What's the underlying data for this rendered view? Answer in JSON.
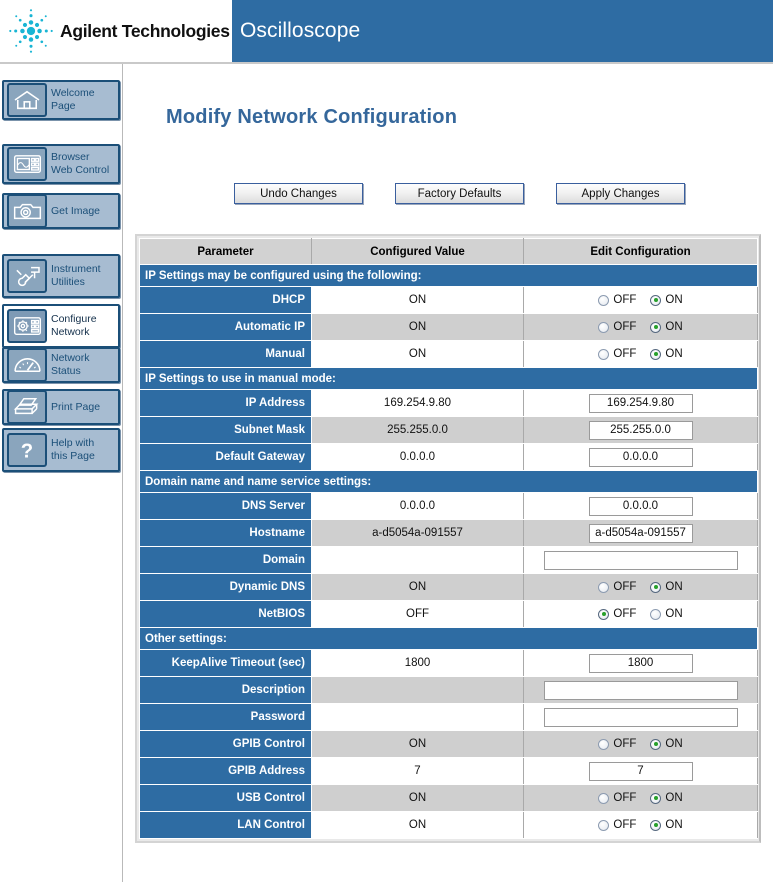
{
  "header": {
    "brand": "Agilent Technologies",
    "app_title": "Oscilloscope",
    "logo_icon": "agilent-starburst-icon",
    "brand_dot_color": "#19b5d4",
    "band_color": "#2e6ca3"
  },
  "sidebar": {
    "items": [
      {
        "label_lines": [
          "Welcome Page"
        ],
        "icon": "house-icon",
        "active": false
      },
      {
        "label_lines": [
          "Browser",
          "Web Control"
        ],
        "icon": "scope-screen-icon",
        "active": false
      },
      {
        "label_lines": [
          "Get Image"
        ],
        "icon": "camera-icon",
        "active": false
      },
      {
        "label_lines": [
          "Instrument",
          "Utilities"
        ],
        "icon": "wrench-tools-icon",
        "active": false
      },
      {
        "label_lines": [
          "Configure",
          "Network"
        ],
        "icon": "gear-scope-icon",
        "active": true
      },
      {
        "label_lines": [
          "Network Status"
        ],
        "icon": "gauge-icon",
        "active": false
      },
      {
        "label_lines": [
          "Print Page"
        ],
        "icon": "printer-icon",
        "active": false
      },
      {
        "label_lines": [
          "Help with",
          "this Page"
        ],
        "icon": "question-mark-icon",
        "active": false
      }
    ]
  },
  "main": {
    "page_title": "Modify Network Configuration",
    "buttons": [
      {
        "label": "Undo Changes",
        "name": "undo-changes-button"
      },
      {
        "label": "Factory Defaults",
        "name": "factory-defaults-button"
      },
      {
        "label": "Apply Changes",
        "name": "apply-changes-button"
      }
    ],
    "table": {
      "columns": [
        "Parameter",
        "Configured Value",
        "Edit Configuration"
      ],
      "rows": [
        {
          "kind": "section",
          "label": "IP Settings may be configured using the following:"
        },
        {
          "kind": "radio",
          "param": "DHCP",
          "value": "ON",
          "selected": "ON",
          "options": [
            "OFF",
            "ON"
          ],
          "shade": "white"
        },
        {
          "kind": "radio",
          "param": "Automatic IP",
          "value": "ON",
          "selected": "ON",
          "options": [
            "OFF",
            "ON"
          ],
          "shade": "gray"
        },
        {
          "kind": "radio",
          "param": "Manual",
          "value": "ON",
          "selected": "ON",
          "options": [
            "OFF",
            "ON"
          ],
          "shade": "white"
        },
        {
          "kind": "section",
          "label": "IP Settings to use in manual mode:"
        },
        {
          "kind": "text",
          "param": "IP Address",
          "value": "169.254.9.80",
          "edit_value": "169.254.9.80",
          "width": "med",
          "shade": "white"
        },
        {
          "kind": "text",
          "param": "Subnet Mask",
          "value": "255.255.0.0",
          "edit_value": "255.255.0.0",
          "width": "med",
          "shade": "gray"
        },
        {
          "kind": "text",
          "param": "Default Gateway",
          "value": "0.0.0.0",
          "edit_value": "0.0.0.0",
          "width": "med",
          "shade": "white"
        },
        {
          "kind": "section",
          "label": "Domain name and name service settings:"
        },
        {
          "kind": "text",
          "param": "DNS Server",
          "value": "0.0.0.0",
          "edit_value": "0.0.0.0",
          "width": "med",
          "shade": "white"
        },
        {
          "kind": "text",
          "param": "Hostname",
          "value": "a-d5054a-091557",
          "edit_value": "a-d5054a-091557",
          "width": "med",
          "shade": "gray"
        },
        {
          "kind": "text",
          "param": "Domain",
          "value": "",
          "edit_value": "",
          "width": "wide",
          "shade": "white"
        },
        {
          "kind": "radio",
          "param": "Dynamic DNS",
          "value": "ON",
          "selected": "ON",
          "options": [
            "OFF",
            "ON"
          ],
          "shade": "gray"
        },
        {
          "kind": "radio",
          "param": "NetBIOS",
          "value": "OFF",
          "selected": "OFF",
          "options": [
            "OFF",
            "ON"
          ],
          "shade": "white"
        },
        {
          "kind": "section",
          "label": "Other settings:"
        },
        {
          "kind": "text",
          "param": "KeepAlive Timeout  (sec)",
          "value": "1800",
          "edit_value": "1800",
          "width": "med",
          "shade": "white"
        },
        {
          "kind": "text",
          "param": "Description",
          "value": "",
          "edit_value": "",
          "width": "wide",
          "shade": "gray"
        },
        {
          "kind": "text",
          "param": "Password",
          "value": "",
          "edit_value": "",
          "width": "wide",
          "shade": "white"
        },
        {
          "kind": "radio",
          "param": "GPIB Control",
          "value": "ON",
          "selected": "ON",
          "options": [
            "OFF",
            "ON"
          ],
          "shade": "gray"
        },
        {
          "kind": "text",
          "param": "GPIB Address",
          "value": "7",
          "edit_value": "7",
          "width": "med",
          "shade": "white"
        },
        {
          "kind": "radio",
          "param": "USB Control",
          "value": "ON",
          "selected": "ON",
          "options": [
            "OFF",
            "ON"
          ],
          "shade": "gray"
        },
        {
          "kind": "radio",
          "param": "LAN Control",
          "value": "ON",
          "selected": "ON",
          "options": [
            "OFF",
            "ON"
          ],
          "shade": "white"
        }
      ]
    }
  },
  "colors": {
    "accent_blue": "#2e6ca3",
    "nav_border": "#1b4f78",
    "nav_fill": "#a7bcd1",
    "title_blue": "#35679b",
    "radio_selected_green": "#27a02b"
  }
}
